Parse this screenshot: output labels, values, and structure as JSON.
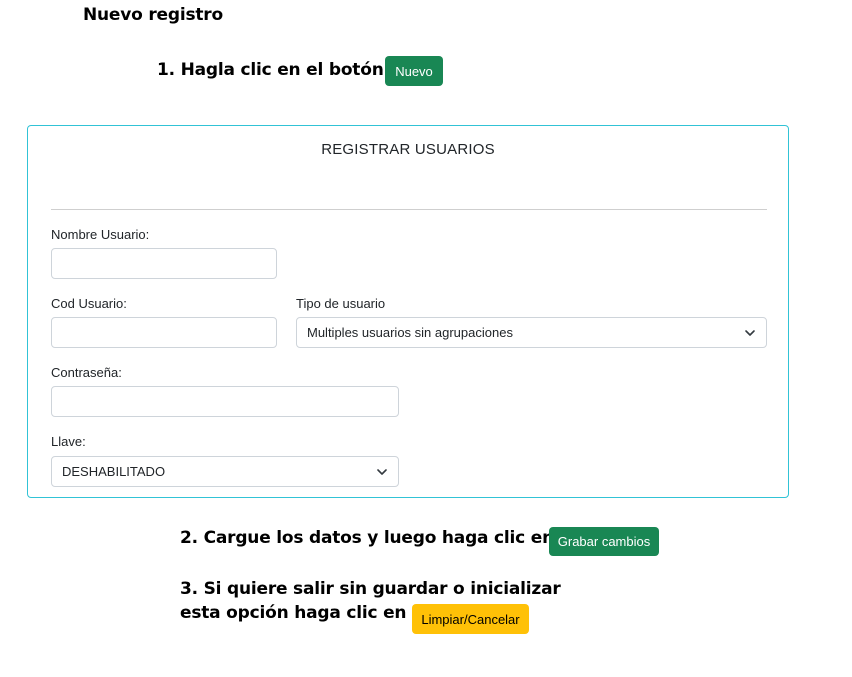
{
  "page_title": "Nuevo registro",
  "step1": {
    "text": "1. Hagla clic en el botón",
    "button": "Nuevo"
  },
  "form": {
    "title": "REGISTRAR USUARIOS",
    "nombre_usuario": {
      "label": "Nombre Usuario:",
      "value": ""
    },
    "cod_usuario": {
      "label": "Cod Usuario:",
      "value": ""
    },
    "tipo_usuario": {
      "label": "Tipo de usuario",
      "selected": "Multiples usuarios sin agrupaciones"
    },
    "contrasena": {
      "label": "Contraseña:",
      "value": ""
    },
    "llave": {
      "label": "Llave:",
      "selected": "DESHABILITADO"
    }
  },
  "step2": {
    "text": "2. Cargue los datos y luego haga clic en",
    "button": "Grabar cambios"
  },
  "step3": {
    "line1": "3.  Si quiere salir sin guardar o inicializar",
    "line2": "esta opción haga clic en",
    "button": "Limpiar/Cancelar"
  },
  "colors": {
    "success": "#198754",
    "warning": "#ffc107",
    "card_border": "#31c3d6"
  }
}
